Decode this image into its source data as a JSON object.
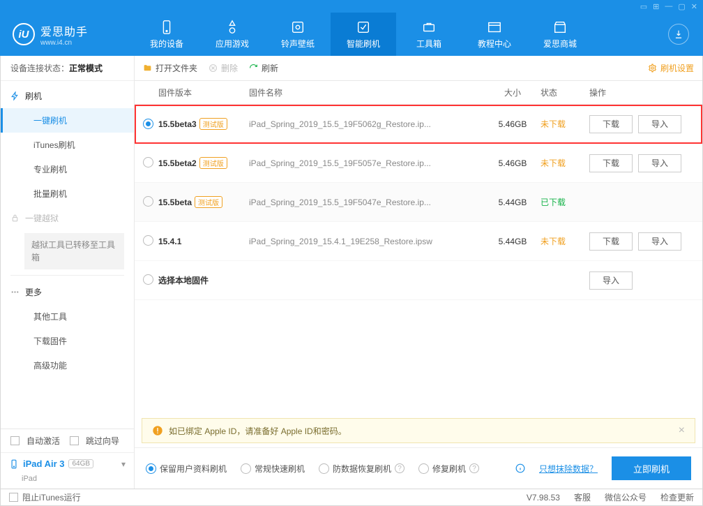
{
  "titlebar_icons": [
    "card",
    "grid",
    "min",
    "max",
    "close"
  ],
  "logo": {
    "title": "爱思助手",
    "subtitle": "www.i4.cn",
    "mark": "iU"
  },
  "nav": [
    {
      "key": "device",
      "label": "我的设备"
    },
    {
      "key": "apps",
      "label": "应用游戏"
    },
    {
      "key": "ring",
      "label": "铃声壁纸"
    },
    {
      "key": "flash",
      "label": "智能刷机",
      "active": true
    },
    {
      "key": "tools",
      "label": "工具箱"
    },
    {
      "key": "tutorial",
      "label": "教程中心"
    },
    {
      "key": "store",
      "label": "爱思商城"
    }
  ],
  "connection": {
    "label": "设备连接状态：",
    "value": "正常模式"
  },
  "sidebar": {
    "group_flash": "刷机",
    "items_flash": [
      "一键刷机",
      "iTunes刷机",
      "专业刷机",
      "批量刷机"
    ],
    "group_jailbreak": "一键越狱",
    "jailbreak_note": "越狱工具已转移至工具箱",
    "group_more": "更多",
    "items_more": [
      "其他工具",
      "下载固件",
      "高级功能"
    ]
  },
  "sidebar_bottom": {
    "auto_activate": "自动激活",
    "skip_guide": "跳过向导",
    "device": {
      "name": "iPad Air 3",
      "storage": "64GB",
      "type": "iPad"
    }
  },
  "toolbar": {
    "open": "打开文件夹",
    "delete": "删除",
    "refresh": "刷新",
    "settings": "刷机设置"
  },
  "columns": {
    "version": "固件版本",
    "name": "固件名称",
    "size": "大小",
    "status": "状态",
    "action": "操作"
  },
  "beta_tag": "测试版",
  "firmware": [
    {
      "selected": true,
      "version": "15.5beta3",
      "beta": true,
      "name": "iPad_Spring_2019_15.5_19F5062g_Restore.ip...",
      "size": "5.46GB",
      "status": "未下载",
      "status_class": "st-pending",
      "actions": [
        "下载",
        "导入"
      ]
    },
    {
      "version": "15.5beta2",
      "beta": true,
      "name": "iPad_Spring_2019_15.5_19F5057e_Restore.ip...",
      "size": "5.46GB",
      "status": "未下载",
      "status_class": "st-pending",
      "actions": [
        "下载",
        "导入"
      ]
    },
    {
      "alt": true,
      "version": "15.5beta",
      "beta": true,
      "name": "iPad_Spring_2019_15.5_19F5047e_Restore.ip...",
      "size": "5.44GB",
      "status": "已下载",
      "status_class": "st-done"
    },
    {
      "version": "15.4.1",
      "name": "iPad_Spring_2019_15.4.1_19E258_Restore.ipsw",
      "size": "5.44GB",
      "status": "未下载",
      "status_class": "st-pending",
      "actions": [
        "下载",
        "导入"
      ]
    },
    {
      "version": "选择本地固件",
      "local": true,
      "actions": [
        "导入"
      ]
    }
  ],
  "tip": "如已绑定 Apple ID，请准备好 Apple ID和密码。",
  "modes": {
    "options": [
      "保留用户资料刷机",
      "常规快速刷机",
      "防数据恢复刷机",
      "修复刷机"
    ],
    "erase_link": "只想抹除数据？",
    "go": "立即刷机"
  },
  "statusbar": {
    "block_itunes": "阻止iTunes运行",
    "version": "V7.98.53",
    "links": [
      "客服",
      "微信公众号",
      "检查更新"
    ]
  }
}
